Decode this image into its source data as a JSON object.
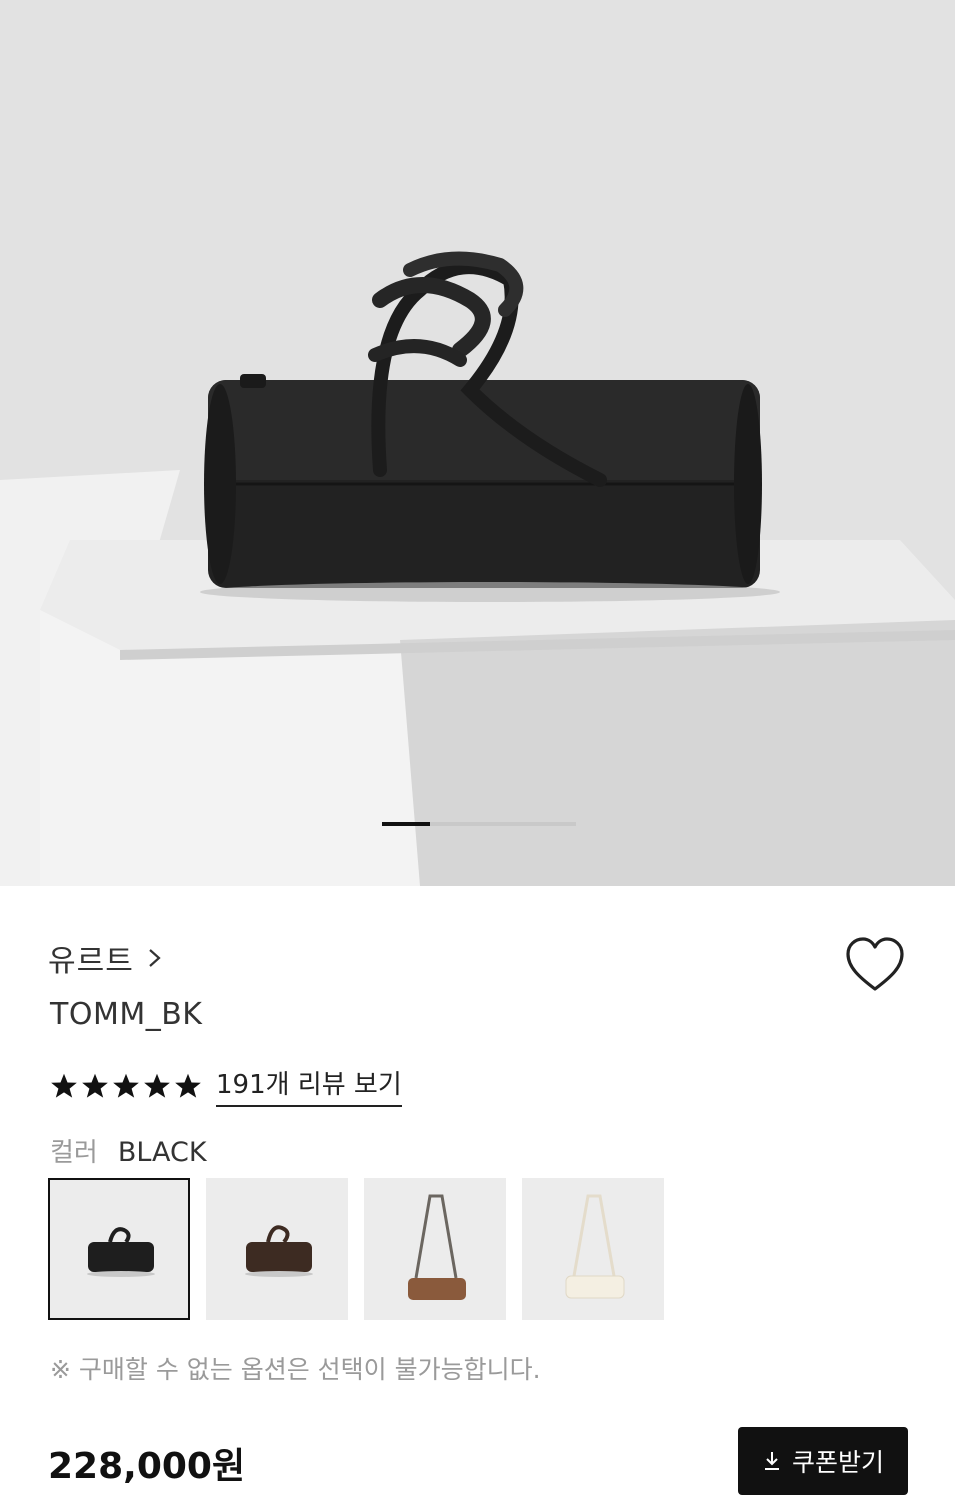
{
  "brand": {
    "name": "유르트",
    "chevron_icon": "chevron-right-icon"
  },
  "product": {
    "name": "TOMM_BK"
  },
  "rating": {
    "stars": 5,
    "max": 5,
    "review_link": "191개 리뷰 보기"
  },
  "color": {
    "label": "컬러",
    "value": "BLACK"
  },
  "swatches": [
    {
      "name": "black",
      "selected": true
    },
    {
      "name": "dark-brown",
      "selected": false
    },
    {
      "name": "brown",
      "selected": false
    },
    {
      "name": "ivory",
      "selected": false
    }
  ],
  "notice": "※ 구매할 수 없는 옵션은 선택이 불가능합니다.",
  "price": "228,000원",
  "coupon_button": {
    "label": "쿠폰받기",
    "icon": "download-icon"
  },
  "carousel": {
    "current_index": 1,
    "total": 4
  },
  "colors": {
    "accent": "#111111",
    "muted": "#9a9a9a"
  }
}
